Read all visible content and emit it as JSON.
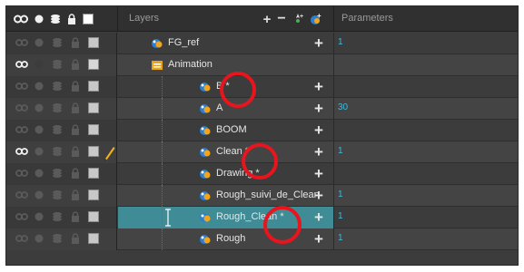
{
  "header": {
    "layers_label": "Layers",
    "parameters_label": "Parameters",
    "buttons": [
      "add-layer",
      "remove-layer",
      "add-peg",
      "add-drawing-layer"
    ]
  },
  "layers": [
    {
      "name": "FG_ref",
      "param": "1",
      "type": "drawing",
      "indent": 0,
      "show_eye": false,
      "alt": false
    },
    {
      "name": "Animation",
      "param": "",
      "type": "group",
      "indent": 0,
      "show_eye": true,
      "alt": true
    },
    {
      "name": "B *",
      "param": "",
      "type": "drawing",
      "indent": 1,
      "show_eye": false,
      "alt": false
    },
    {
      "name": "A",
      "param": "30",
      "type": "drawing",
      "indent": 1,
      "show_eye": false,
      "alt": true
    },
    {
      "name": "BOOM",
      "param": "",
      "type": "drawing",
      "indent": 1,
      "show_eye": false,
      "alt": false
    },
    {
      "name": "Clean *",
      "param": "1",
      "type": "drawing",
      "indent": 1,
      "show_eye": true,
      "alt": true
    },
    {
      "name": "Drawing *",
      "param": "",
      "type": "drawing",
      "indent": 1,
      "show_eye": false,
      "alt": false
    },
    {
      "name": "Rough_suivi_de_Clean",
      "param": "1",
      "type": "drawing",
      "indent": 1,
      "show_eye": false,
      "alt": true
    },
    {
      "name": "Rough_Clean *",
      "param": "1",
      "type": "drawing",
      "indent": 1,
      "show_eye": false,
      "alt": false,
      "selected": true
    },
    {
      "name": "Rough",
      "param": "1",
      "type": "drawing",
      "indent": 1,
      "show_eye": false,
      "alt": true
    }
  ],
  "colors": {
    "background": "#3c3c3c",
    "selected_row": "#3f8c96",
    "param_value": "#46b7d8",
    "annotation_circle": "#e8141e"
  }
}
